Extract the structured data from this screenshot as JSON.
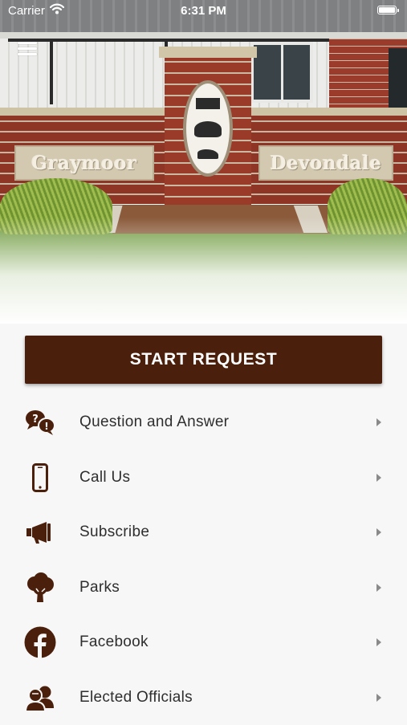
{
  "status_bar": {
    "carrier": "Carrier",
    "time": "6:31 PM"
  },
  "hero": {
    "sign_left": "Graymoor",
    "sign_right": "Devondale"
  },
  "main": {
    "start_request_label": "START REQUEST"
  },
  "menu": {
    "items": [
      {
        "label": "Question and Answer",
        "icon": "question-answer-icon"
      },
      {
        "label": "Call Us",
        "icon": "phone-icon"
      },
      {
        "label": "Subscribe",
        "icon": "megaphone-icon"
      },
      {
        "label": "Parks",
        "icon": "tree-icon"
      },
      {
        "label": "Facebook",
        "icon": "facebook-icon"
      },
      {
        "label": "Elected Officials",
        "icon": "users-icon"
      }
    ]
  },
  "colors": {
    "accent": "#4a1f0b",
    "icon": "#4a1f0b",
    "text": "#2e2e2e",
    "background": "#f7f7f7"
  }
}
